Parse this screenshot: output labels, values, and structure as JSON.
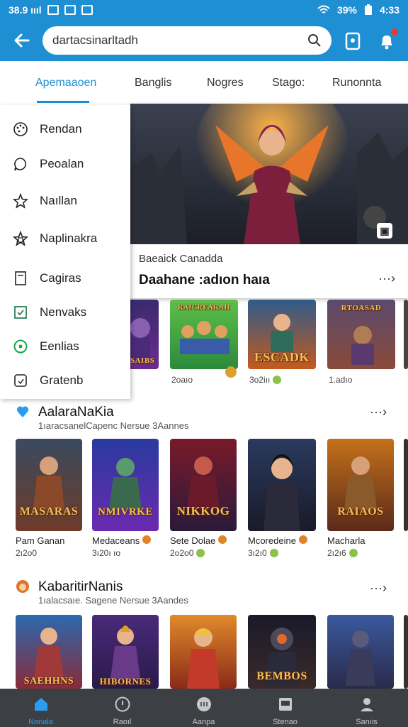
{
  "status_bar": {
    "signal": "38.9 ıııl",
    "battery": "39%",
    "time": "4:33"
  },
  "header": {
    "search_value": "dartacsinarltadh",
    "notification_count": "1"
  },
  "tabs": [
    {
      "label": "Apemaaoen",
      "active": true
    },
    {
      "label": "Banglis"
    },
    {
      "label": "Nogres"
    },
    {
      "label": "Stago:"
    },
    {
      "label": "Runonnta"
    }
  ],
  "drawer": {
    "items": [
      {
        "label": "Rendan",
        "icon": "palette-icon"
      },
      {
        "label": "Peoalan",
        "icon": "chat-icon"
      },
      {
        "label": "Naıllan",
        "icon": "star-icon"
      },
      {
        "label": "Naplinakra",
        "icon": "star-badge-icon"
      },
      {
        "label": "Cagiras",
        "icon": "document-icon"
      },
      {
        "label": "Nenvaks",
        "icon": "check-box-icon"
      },
      {
        "label": "Eenlias",
        "icon": "chat-circle-icon"
      },
      {
        "label": "Gratenb",
        "icon": "tag-icon"
      }
    ]
  },
  "banner": {
    "subtitle": "Baeaick Canadda",
    "title": "Daahane :adıon haıa",
    "more": "···›"
  },
  "row1": [
    {
      "art": "RSAIBS",
      "name": "",
      "meta": "",
      "badge": "#e0842a"
    },
    {
      "art": "RAICREARAH",
      "name": "",
      "meta": "2oaıo",
      "badge": "#d9a22d"
    },
    {
      "art": "ESCADK",
      "name": "",
      "meta": "3o2iıı",
      "badge": "#8bc34a"
    },
    {
      "art": "RTOASAD",
      "name": "",
      "meta": "1.adıo",
      "badge": ""
    }
  ],
  "section1": {
    "title": "AalaraNaKia",
    "subtitle": "1ıaracsanelCapenc Nersue 3Aannes",
    "more": "···›",
    "cards": [
      {
        "art": "MASARAS",
        "name": "Pam Ganan",
        "meta": "2ı2o0",
        "badge": ""
      },
      {
        "art": "NMIVRKE",
        "name": "Medaceans",
        "meta": "3ı20ı ıo",
        "badge": "#e0842a"
      },
      {
        "art": "NIKKOG",
        "name": "Sete Dolae",
        "meta": "2o2o0",
        "badge": "#e0842a"
      },
      {
        "art": "",
        "name": "Mcoredeine",
        "meta": "3ı2ı0",
        "badge": "#e0842a"
      },
      {
        "art": "RAIAOS",
        "name": "Macharla",
        "meta": "2ı2ı6",
        "badge": "#8bc34a"
      }
    ]
  },
  "section2": {
    "title": "KabaritirNanis",
    "subtitle": "1ıalacsaıe. Sagene Nersue 3Aandes",
    "more": "···›",
    "cards": [
      {
        "art": "SAEHHNS"
      },
      {
        "art": "HIBORNES"
      },
      {
        "art": ""
      },
      {
        "art": "BEMBOS"
      },
      {
        "art": ""
      }
    ]
  },
  "bottom_nav": [
    {
      "label": "Nanala",
      "icon": "home-icon",
      "active": true
    },
    {
      "label": "Raoıl",
      "icon": "info-icon"
    },
    {
      "label": "Aanpa",
      "icon": "game-controller-icon"
    },
    {
      "label": "Stenao",
      "icon": "tablet-icon"
    },
    {
      "label": "Sanıis",
      "icon": "profile-icon"
    }
  ],
  "colors": {
    "primary": "#1f8fd3",
    "nav_bg": "#3c3f44",
    "nav_active": "#2b9cf0"
  }
}
